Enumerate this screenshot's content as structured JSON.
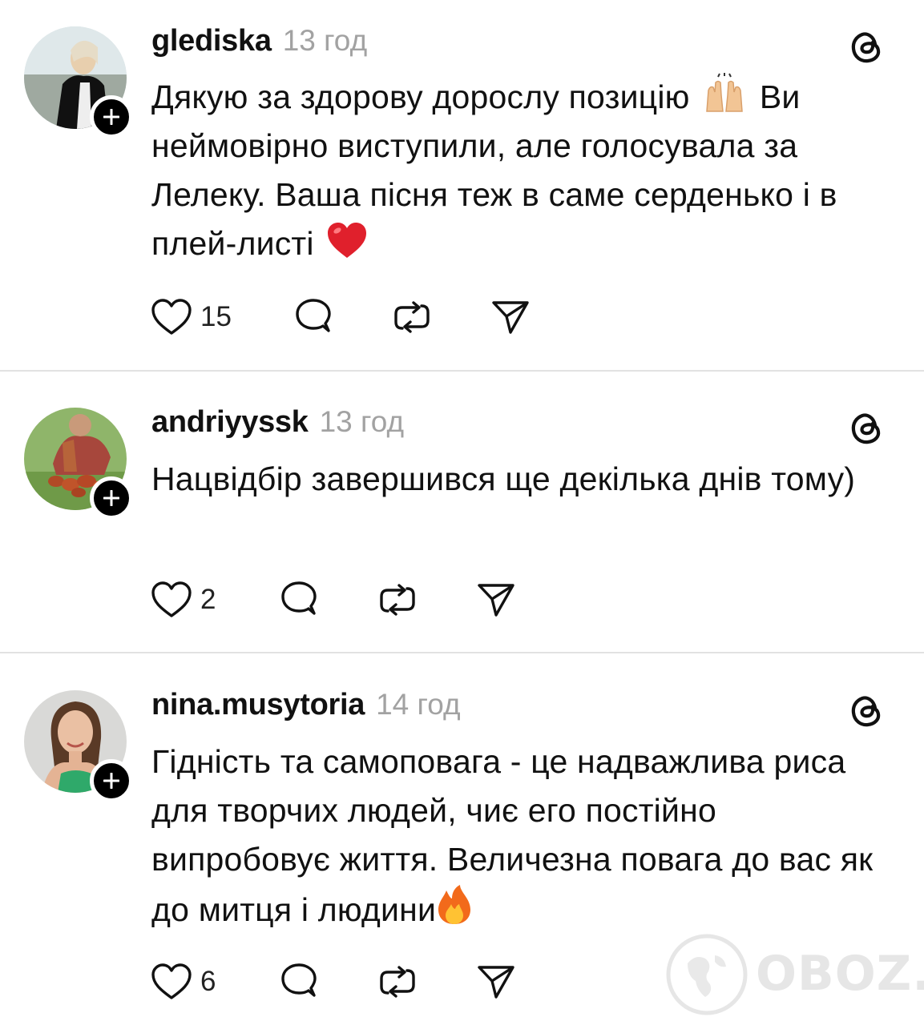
{
  "posts": [
    {
      "username": "glediska",
      "time": "13 год",
      "text_before_emoji": "Дякую за здорову дорослу позицію",
      "emoji_1": "raising-hands",
      "text_after_emoji": " Ви неймовірно виступили, але голосувала за Лелеку. Ваша пісня теж в саме серденько і в плей-листі",
      "emoji_2": "red-heart",
      "likes": "15"
    },
    {
      "username": "andriyyssk",
      "time": "13 год",
      "text": "Нацвідбір завершився ще декілька днів тому)",
      "likes": "2"
    },
    {
      "username": "nina.musytoria",
      "time": "14 год",
      "text": "Гідність та самоповага - це надважлива риса для творчих людей, чиє его постійно випробовує життя. Величезна повага до вас як до митця і людини",
      "emoji": "fire",
      "likes": "6"
    }
  ],
  "watermark": {
    "text": "OBOZ.UA"
  },
  "colors": {
    "text": "#111111",
    "muted": "#a2a2a2",
    "divider": "#e2e2e2",
    "heart_red": "#e0202c",
    "badge": "#000000"
  }
}
